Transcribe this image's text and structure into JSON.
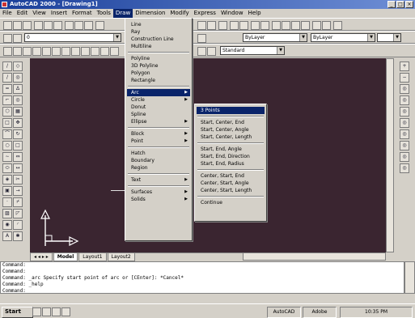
{
  "window": {
    "title": "AutoCAD 2000 - [Drawing1]"
  },
  "menubar": [
    "File",
    "Edit",
    "View",
    "Insert",
    "Format",
    "Tools",
    "Draw",
    "Dimension",
    "Modify",
    "Express",
    "Window",
    "Help"
  ],
  "toolbar2": {
    "layer_combo": "0",
    "color_combo": "ByLayer",
    "linetype_combo": "ByLayer"
  },
  "toolbar3": {
    "style_combo": "Standard"
  },
  "draw_menu": {
    "items": [
      "Line",
      "Ray",
      "Construction Line",
      "Multiline",
      "Polyline",
      "3D Polyline",
      "Polygon",
      "Rectangle",
      "Arc",
      "Circle",
      "Donut",
      "Spline",
      "Ellipse",
      "Block",
      "Point",
      "Hatch",
      "Boundary",
      "Region",
      "Text",
      "Surfaces",
      "Solids"
    ],
    "active_item": "Arc"
  },
  "arc_submenu": {
    "items": [
      "3 Points",
      "Start, Center, End",
      "Start, Center, Angle",
      "Start, Center, Length",
      "Start, End, Angle",
      "Start, End, Direction",
      "Start, End, Radius",
      "Center, Start, End",
      "Center, Start, Angle",
      "Center, Start, Length",
      "Continue"
    ],
    "highlighted_item": "3 Points"
  },
  "layout_tabs": [
    "Model",
    "Layout1",
    "Layout2"
  ],
  "active_tab": "Model",
  "command_lines": [
    "Command:",
    "Command:",
    "Command: _arc Specify start point of arc or [CEnter]: *Cancel*",
    "Command: _help",
    "Command:"
  ],
  "taskbar": {
    "start_label": "Start",
    "tray": [
      "AutoCAD",
      "Adobe",
      "10:35 PM"
    ]
  }
}
